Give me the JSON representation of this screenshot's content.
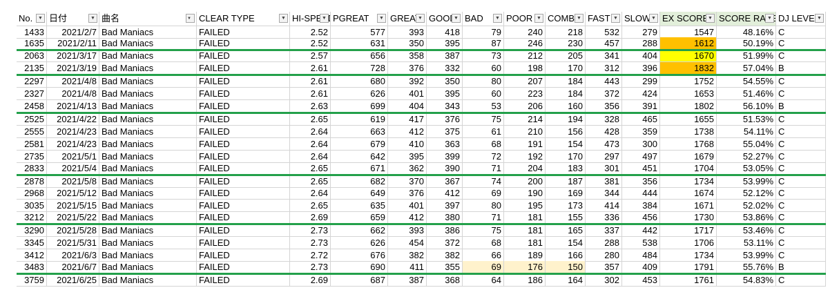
{
  "header": {
    "columns": [
      {
        "label": "No.",
        "filter": "dropdown"
      },
      {
        "label": "日付",
        "filter": "dropdown"
      },
      {
        "label": "曲名",
        "filter": "filtered"
      },
      {
        "label": "CLEAR TYPE",
        "filter": "dropdown"
      },
      {
        "label": "HI-SPEED",
        "filter": "dropdown"
      },
      {
        "label": "PGREAT",
        "filter": "dropdown"
      },
      {
        "label": "GREAT",
        "filter": "dropdown"
      },
      {
        "label": "GOOD",
        "filter": "dropdown"
      },
      {
        "label": "BAD",
        "filter": "dropdown"
      },
      {
        "label": "POOR",
        "filter": "dropdown"
      },
      {
        "label": "COMBO",
        "filter": "dropdown"
      },
      {
        "label": "FAST",
        "filter": "dropdown"
      },
      {
        "label": "SLOW",
        "filter": "dropdown"
      },
      {
        "label": "EX SCORE",
        "filter": "dropdown"
      },
      {
        "label": "SCORE RATE",
        "filter": "dropdown"
      },
      {
        "label": "DJ LEVEL",
        "filter": "dropdown"
      }
    ],
    "highlighted_header_color": "#e2efda"
  },
  "rows": [
    {
      "cells": [
        "1433",
        "2021/2/7",
        "Bad Maniacs",
        "FAILED",
        "2.52",
        "577",
        "393",
        "418",
        "79",
        "240",
        "218",
        "532",
        "279",
        "1547",
        "48.16%",
        "C"
      ]
    },
    {
      "cells": [
        "1635",
        "2021/2/11",
        "Bad Maniacs",
        "FAILED",
        "2.52",
        "631",
        "350",
        "395",
        "87",
        "246",
        "230",
        "457",
        "288",
        "1612",
        "50.19%",
        "C"
      ],
      "fill": {
        "13": "#ffc000"
      }
    },
    {
      "cells": [
        "2063",
        "2021/3/17",
        "Bad Maniacs",
        "FAILED",
        "2.57",
        "656",
        "358",
        "387",
        "73",
        "212",
        "205",
        "341",
        "404",
        "1670",
        "51.99%",
        "C"
      ],
      "fill": {
        "13": "#ffff00"
      }
    },
    {
      "cells": [
        "2135",
        "2021/3/19",
        "Bad Maniacs",
        "FAILED",
        "2.61",
        "728",
        "376",
        "332",
        "60",
        "198",
        "170",
        "312",
        "396",
        "1832",
        "57.04%",
        "B"
      ],
      "fill": {
        "13": "#ffc000"
      }
    },
    {
      "cells": [
        "2297",
        "2021/4/8",
        "Bad Maniacs",
        "FAILED",
        "2.61",
        "680",
        "392",
        "350",
        "80",
        "207",
        "184",
        "443",
        "299",
        "1752",
        "54.55%",
        "C"
      ]
    },
    {
      "cells": [
        "2327",
        "2021/4/8",
        "Bad Maniacs",
        "FAILED",
        "2.61",
        "626",
        "401",
        "395",
        "60",
        "223",
        "184",
        "372",
        "424",
        "1653",
        "51.46%",
        "C"
      ]
    },
    {
      "cells": [
        "2458",
        "2021/4/13",
        "Bad Maniacs",
        "FAILED",
        "2.63",
        "699",
        "404",
        "343",
        "53",
        "206",
        "160",
        "356",
        "391",
        "1802",
        "56.10%",
        "B"
      ]
    },
    {
      "cells": [
        "2525",
        "2021/4/22",
        "Bad Maniacs",
        "FAILED",
        "2.65",
        "619",
        "417",
        "376",
        "75",
        "214",
        "194",
        "328",
        "465",
        "1655",
        "51.53%",
        "C"
      ]
    },
    {
      "cells": [
        "2555",
        "2021/4/23",
        "Bad Maniacs",
        "FAILED",
        "2.64",
        "663",
        "412",
        "375",
        "61",
        "210",
        "156",
        "428",
        "359",
        "1738",
        "54.11%",
        "C"
      ]
    },
    {
      "cells": [
        "2581",
        "2021/4/23",
        "Bad Maniacs",
        "FAILED",
        "2.64",
        "679",
        "410",
        "363",
        "68",
        "191",
        "154",
        "473",
        "300",
        "1768",
        "55.04%",
        "C"
      ]
    },
    {
      "cells": [
        "2735",
        "2021/5/1",
        "Bad Maniacs",
        "FAILED",
        "2.64",
        "642",
        "395",
        "399",
        "72",
        "192",
        "170",
        "297",
        "497",
        "1679",
        "52.27%",
        "C"
      ]
    },
    {
      "cells": [
        "2833",
        "2021/5/4",
        "Bad Maniacs",
        "FAILED",
        "2.65",
        "671",
        "362",
        "390",
        "71",
        "204",
        "183",
        "301",
        "451",
        "1704",
        "53.05%",
        "C"
      ]
    },
    {
      "cells": [
        "2878",
        "2021/5/8",
        "Bad Maniacs",
        "FAILED",
        "2.65",
        "682",
        "370",
        "367",
        "74",
        "200",
        "187",
        "381",
        "356",
        "1734",
        "53.99%",
        "C"
      ]
    },
    {
      "cells": [
        "2968",
        "2021/5/12",
        "Bad Maniacs",
        "FAILED",
        "2.64",
        "649",
        "376",
        "412",
        "69",
        "190",
        "169",
        "344",
        "444",
        "1674",
        "52.12%",
        "C"
      ]
    },
    {
      "cells": [
        "3035",
        "2021/5/15",
        "Bad Maniacs",
        "FAILED",
        "2.65",
        "635",
        "401",
        "397",
        "80",
        "195",
        "173",
        "414",
        "384",
        "1671",
        "52.02%",
        "C"
      ]
    },
    {
      "cells": [
        "3212",
        "2021/5/22",
        "Bad Maniacs",
        "FAILED",
        "2.69",
        "659",
        "412",
        "380",
        "71",
        "181",
        "155",
        "336",
        "456",
        "1730",
        "53.86%",
        "C"
      ]
    },
    {
      "cells": [
        "3290",
        "2021/5/28",
        "Bad Maniacs",
        "FAILED",
        "2.73",
        "662",
        "393",
        "386",
        "75",
        "181",
        "165",
        "337",
        "442",
        "1717",
        "53.46%",
        "C"
      ]
    },
    {
      "cells": [
        "3345",
        "2021/5/31",
        "Bad Maniacs",
        "FAILED",
        "2.73",
        "626",
        "454",
        "372",
        "68",
        "181",
        "154",
        "288",
        "538",
        "1706",
        "53.11%",
        "C"
      ]
    },
    {
      "cells": [
        "3412",
        "2021/6/3",
        "Bad Maniacs",
        "FAILED",
        "2.72",
        "676",
        "382",
        "382",
        "66",
        "189",
        "166",
        "280",
        "484",
        "1734",
        "53.99%",
        "C"
      ]
    },
    {
      "cells": [
        "3483",
        "2021/6/7",
        "Bad Maniacs",
        "FAILED",
        "2.73",
        "690",
        "411",
        "355",
        "69",
        "176",
        "150",
        "357",
        "409",
        "1791",
        "55.76%",
        "B"
      ],
      "fill": {
        "8": "#fff2cc",
        "9": "#fff2cc",
        "10": "#fff2cc"
      }
    },
    {
      "cells": [
        "3759",
        "2021/6/25",
        "Bad Maniacs",
        "FAILED",
        "2.69",
        "687",
        "387",
        "368",
        "64",
        "186",
        "164",
        "302",
        "453",
        "1761",
        "54.83%",
        "C"
      ]
    }
  ],
  "group_separator_color": "#23a04a",
  "icons": {
    "dropdown": "chevron-down-icon",
    "filtered": "filter-icon"
  }
}
